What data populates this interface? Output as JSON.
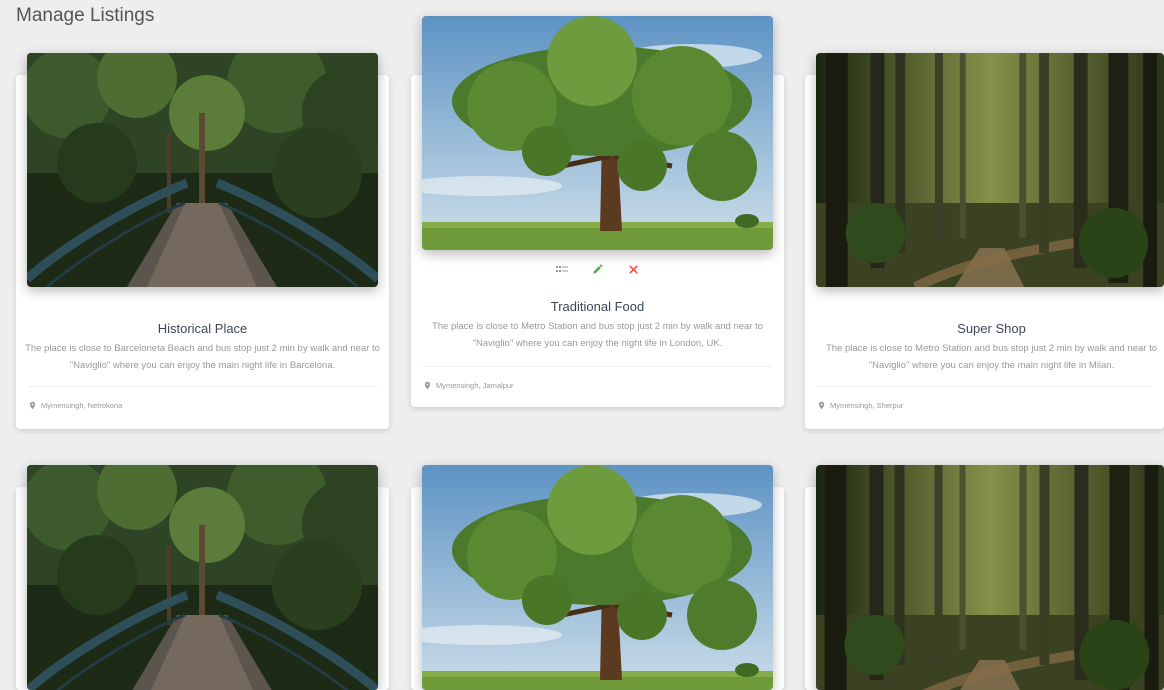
{
  "page": {
    "title": "Manage Listings"
  },
  "cards": [
    {
      "title": "Historical Place",
      "description": "The place is close to Barceloneta Beach and bus stop just 2 min by walk and near to \"Naviglio\" where you can enjoy the main night life in Barcelona.",
      "location": "Mymensingh, Netrokona",
      "image": "bridge"
    },
    {
      "title": "Traditional Food",
      "description": "The place is close to Metro Station and bus stop just 2 min by walk and near to \"Naviglio\" where you can enjoy the night life in London, UK.",
      "location": "Mymensingh, Jamalpur",
      "image": "tree",
      "actions": [
        "view-icon",
        "edit-icon",
        "remove-icon"
      ]
    },
    {
      "title": "Super Shop",
      "description": "The place is close to Metro Station and bus stop just 2 min by walk and near to \"Naviglio\" where you can enjoy the main night life in Milan.",
      "location": "Mymensingh, Sherpur",
      "image": "forest"
    },
    {
      "image": "bridge"
    },
    {
      "image": "tree"
    },
    {
      "image": "forest"
    }
  ],
  "colors": {
    "edit": "#4caf50",
    "remove": "#f44336",
    "view": "#999999"
  }
}
